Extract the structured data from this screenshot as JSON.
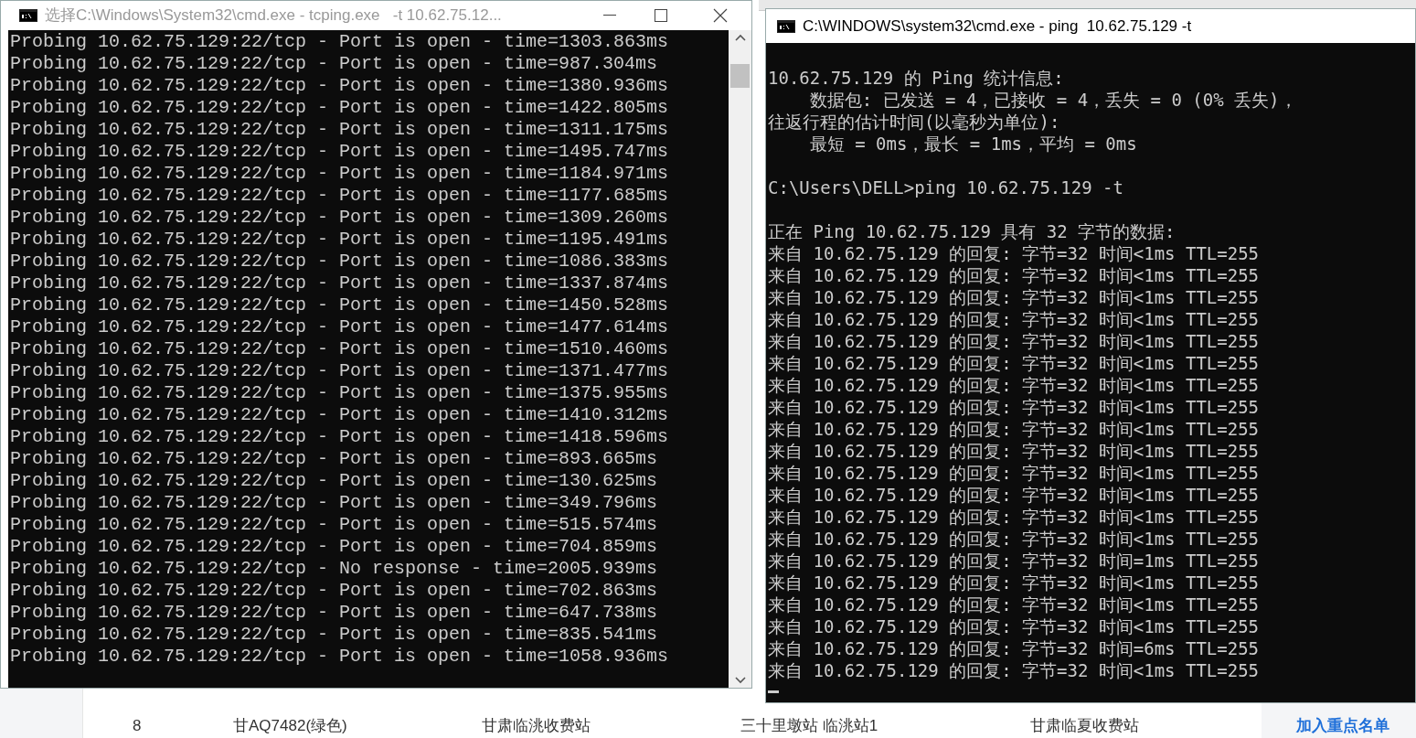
{
  "background_table": {
    "row": {
      "index": "8",
      "plate": "甘AQ7482(绿色)",
      "entry_station": "甘肃临洮收费站",
      "route": "三十里墩站 临洮站1",
      "exit_station": "甘肃临夏收费站",
      "action": "加入重点名单"
    }
  },
  "tcping_window": {
    "title": "选择C:\\Windows\\System32\\cmd.exe - tcping.exe   -t 10.62.75.12...",
    "lines": [
      "Probing 10.62.75.129:22/tcp - Port is open - time=1303.863ms",
      "Probing 10.62.75.129:22/tcp - Port is open - time=987.304ms",
      "Probing 10.62.75.129:22/tcp - Port is open - time=1380.936ms",
      "Probing 10.62.75.129:22/tcp - Port is open - time=1422.805ms",
      "Probing 10.62.75.129:22/tcp - Port is open - time=1311.175ms",
      "Probing 10.62.75.129:22/tcp - Port is open - time=1495.747ms",
      "Probing 10.62.75.129:22/tcp - Port is open - time=1184.971ms",
      "Probing 10.62.75.129:22/tcp - Port is open - time=1177.685ms",
      "Probing 10.62.75.129:22/tcp - Port is open - time=1309.260ms",
      "Probing 10.62.75.129:22/tcp - Port is open - time=1195.491ms",
      "Probing 10.62.75.129:22/tcp - Port is open - time=1086.383ms",
      "Probing 10.62.75.129:22/tcp - Port is open - time=1337.874ms",
      "Probing 10.62.75.129:22/tcp - Port is open - time=1450.528ms",
      "Probing 10.62.75.129:22/tcp - Port is open - time=1477.614ms",
      "Probing 10.62.75.129:22/tcp - Port is open - time=1510.460ms",
      "Probing 10.62.75.129:22/tcp - Port is open - time=1371.477ms",
      "Probing 10.62.75.129:22/tcp - Port is open - time=1375.955ms",
      "Probing 10.62.75.129:22/tcp - Port is open - time=1410.312ms",
      "Probing 10.62.75.129:22/tcp - Port is open - time=1418.596ms",
      "Probing 10.62.75.129:22/tcp - Port is open - time=893.665ms",
      "Probing 10.62.75.129:22/tcp - Port is open - time=130.625ms",
      "Probing 10.62.75.129:22/tcp - Port is open - time=349.796ms",
      "Probing 10.62.75.129:22/tcp - Port is open - time=515.574ms",
      "Probing 10.62.75.129:22/tcp - Port is open - time=704.859ms",
      "Probing 10.62.75.129:22/tcp - No response - time=2005.939ms",
      "Probing 10.62.75.129:22/tcp - Port is open - time=702.863ms",
      "Probing 10.62.75.129:22/tcp - Port is open - time=647.738ms",
      "Probing 10.62.75.129:22/tcp - Port is open - time=835.541ms",
      "Probing 10.62.75.129:22/tcp - Port is open - time=1058.936ms"
    ]
  },
  "ping_window": {
    "title": "C:\\WINDOWS\\system32\\cmd.exe - ping  10.62.75.129 -t",
    "blocks": [
      [
        "10.62.75.129 的 Ping 统计信息:",
        "    数据包: 已发送 = 4，已接收 = 4，丢失 = 0 (0% 丢失)，",
        "往返行程的估计时间(以毫秒为单位):",
        "    最短 = 0ms，最长 = 1ms，平均 = 0ms"
      ],
      [
        "C:\\Users\\DELL>ping 10.62.75.129 -t"
      ],
      [
        "正在 Ping 10.62.75.129 具有 32 字节的数据:",
        "来自 10.62.75.129 的回复: 字节=32 时间<1ms TTL=255",
        "来自 10.62.75.129 的回复: 字节=32 时间<1ms TTL=255",
        "来自 10.62.75.129 的回复: 字节=32 时间<1ms TTL=255",
        "来自 10.62.75.129 的回复: 字节=32 时间<1ms TTL=255",
        "来自 10.62.75.129 的回复: 字节=32 时间<1ms TTL=255",
        "来自 10.62.75.129 的回复: 字节=32 时间<1ms TTL=255",
        "来自 10.62.75.129 的回复: 字节=32 时间<1ms TTL=255",
        "来自 10.62.75.129 的回复: 字节=32 时间<1ms TTL=255",
        "来自 10.62.75.129 的回复: 字节=32 时间<1ms TTL=255",
        "来自 10.62.75.129 的回复: 字节=32 时间<1ms TTL=255",
        "来自 10.62.75.129 的回复: 字节=32 时间<1ms TTL=255",
        "来自 10.62.75.129 的回复: 字节=32 时间<1ms TTL=255",
        "来自 10.62.75.129 的回复: 字节=32 时间<1ms TTL=255",
        "来自 10.62.75.129 的回复: 字节=32 时间<1ms TTL=255",
        "来自 10.62.75.129 的回复: 字节=32 时间=1ms TTL=255",
        "来自 10.62.75.129 的回复: 字节=32 时间<1ms TTL=255",
        "来自 10.62.75.129 的回复: 字节=32 时间<1ms TTL=255",
        "来自 10.62.75.129 的回复: 字节=32 时间<1ms TTL=255",
        "来自 10.62.75.129 的回复: 字节=32 时间=6ms TTL=255",
        "来自 10.62.75.129 的回复: 字节=32 时间<1ms TTL=255"
      ]
    ]
  }
}
